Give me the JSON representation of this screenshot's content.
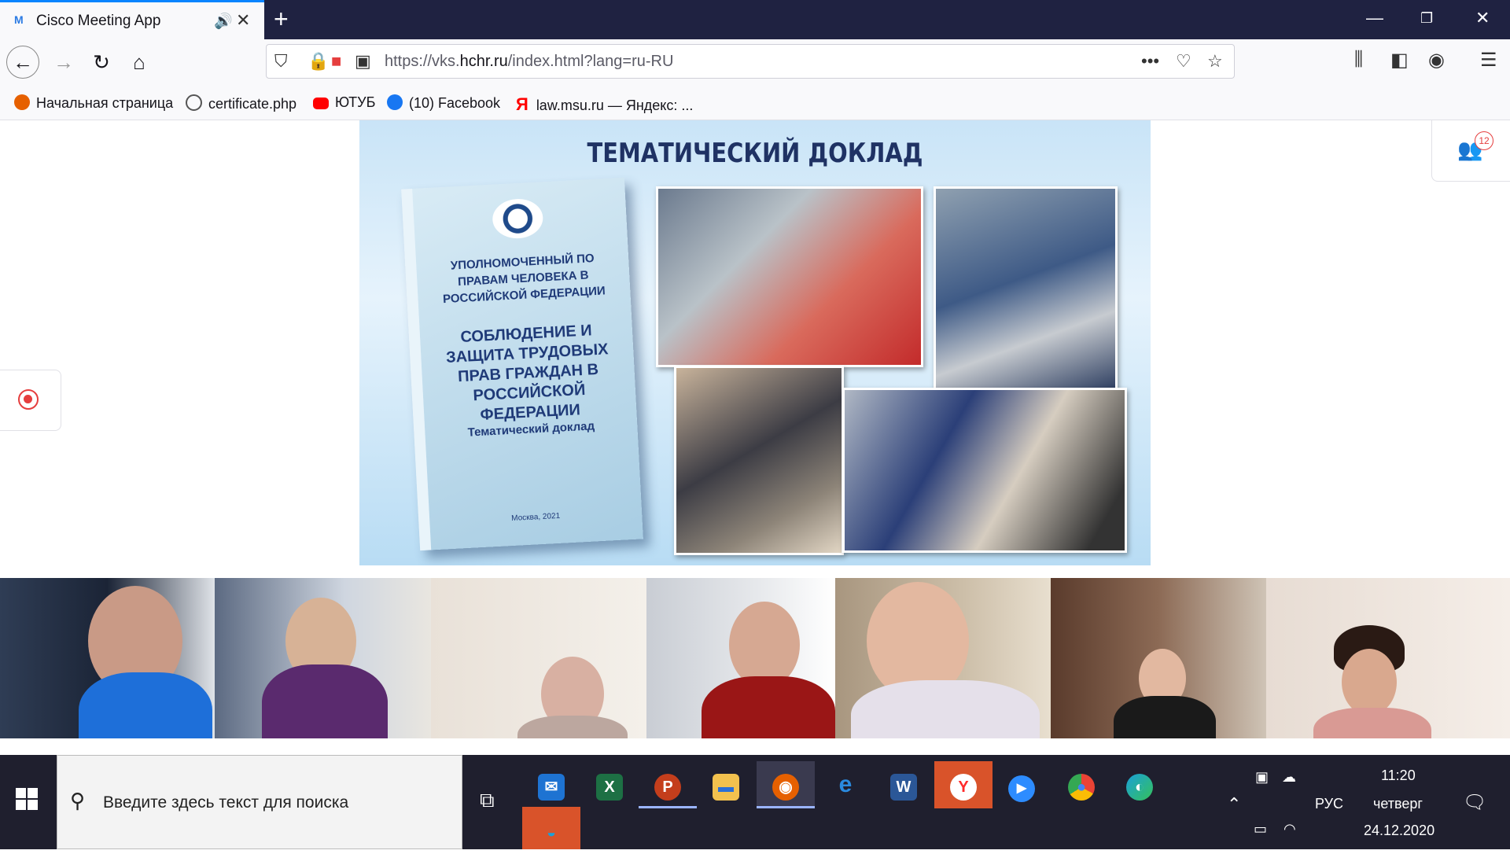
{
  "browser": {
    "tab": {
      "favicon": "M",
      "title": "Cisco Meeting App"
    },
    "url": {
      "prefix": "https://vks.",
      "domain": "hchr.ru",
      "path": "/index.html?lang=ru-RU"
    },
    "bookmarks": [
      {
        "label": "Начальная страница",
        "icon": "firefox-icon",
        "color": "#e66000"
      },
      {
        "label": "certificate.php",
        "icon": "globe-icon",
        "color": "#555555"
      },
      {
        "label": "ЮТУБ",
        "icon": "youtube-icon",
        "color": "#ff0000"
      },
      {
        "label": "(10) Facebook",
        "icon": "facebook-icon",
        "color": "#1877f2"
      },
      {
        "label": "law.msu.ru — Яндекс: ...",
        "icon": "yandex-icon",
        "color": "#ff0000"
      }
    ]
  },
  "meeting": {
    "slide": {
      "title": "ТЕМАТИЧЕСКИЙ ДОКЛАД",
      "book_org": "УПОЛНОМОЧЕННЫЙ ПО ПРАВАМ ЧЕЛОВЕКА В РОССИЙСКОЙ ФЕДЕРАЦИИ",
      "book_title": "СОБЛЮДЕНИЕ И ЗАЩИТА ТРУДОВЫХ ПРАВ ГРАЖДАН В РОССИЙСКОЙ ФЕДЕРАЦИИ",
      "book_subtitle": "Тематический доклад",
      "book_footer": "Москва, 2021"
    },
    "participants_count": "12",
    "participants": [
      {
        "name": "participant-1",
        "bg": "#2f3d55",
        "accent": "#1e6fd9"
      },
      {
        "name": "participant-2",
        "bg": "#6a7890",
        "accent": "#5a2a6e"
      },
      {
        "name": "participant-3",
        "bg": "#efe9e2",
        "accent": "#c9b8b0"
      },
      {
        "name": "participant-4",
        "bg": "#d9dbe0",
        "accent": "#9a1616"
      },
      {
        "name": "participant-5",
        "bg": "#b6a58e",
        "accent": "#e5e0ea"
      },
      {
        "name": "participant-6",
        "bg": "#6b4a3a",
        "accent": "#1a1a1a"
      },
      {
        "name": "participant-7",
        "bg": "#e7dcd3",
        "accent": "#d99a94"
      }
    ]
  },
  "taskbar": {
    "search_placeholder": "Введите здесь текст для поиска",
    "apps": [
      {
        "name": "mail-app",
        "glyph": "✉",
        "color": "#1e73d2"
      },
      {
        "name": "excel-app",
        "glyph": "X",
        "color": "#1d7044"
      },
      {
        "name": "powerpoint-app",
        "glyph": "P",
        "color": "#c43e1c"
      },
      {
        "name": "explorer-app",
        "glyph": "▬",
        "color": "#f2c14e"
      },
      {
        "name": "firefox-app",
        "glyph": "◉",
        "color": "#e66000"
      },
      {
        "name": "ie-app",
        "glyph": "e",
        "color": "#2a8be0"
      },
      {
        "name": "word-app",
        "glyph": "W",
        "color": "#2b5797"
      },
      {
        "name": "yandex-app",
        "glyph": "Y",
        "color": "#ff2a2a"
      },
      {
        "name": "zoom-app",
        "glyph": "▶",
        "color": "#2d8cff"
      },
      {
        "name": "chrome-app",
        "glyph": "●",
        "color": "#34a853"
      },
      {
        "name": "edge-app",
        "glyph": "◐",
        "color": "#1aa0d9"
      }
    ],
    "tray": {
      "lang": "РУС",
      "time": "11:20",
      "day": "четверг",
      "date": "24.12.2020"
    }
  }
}
